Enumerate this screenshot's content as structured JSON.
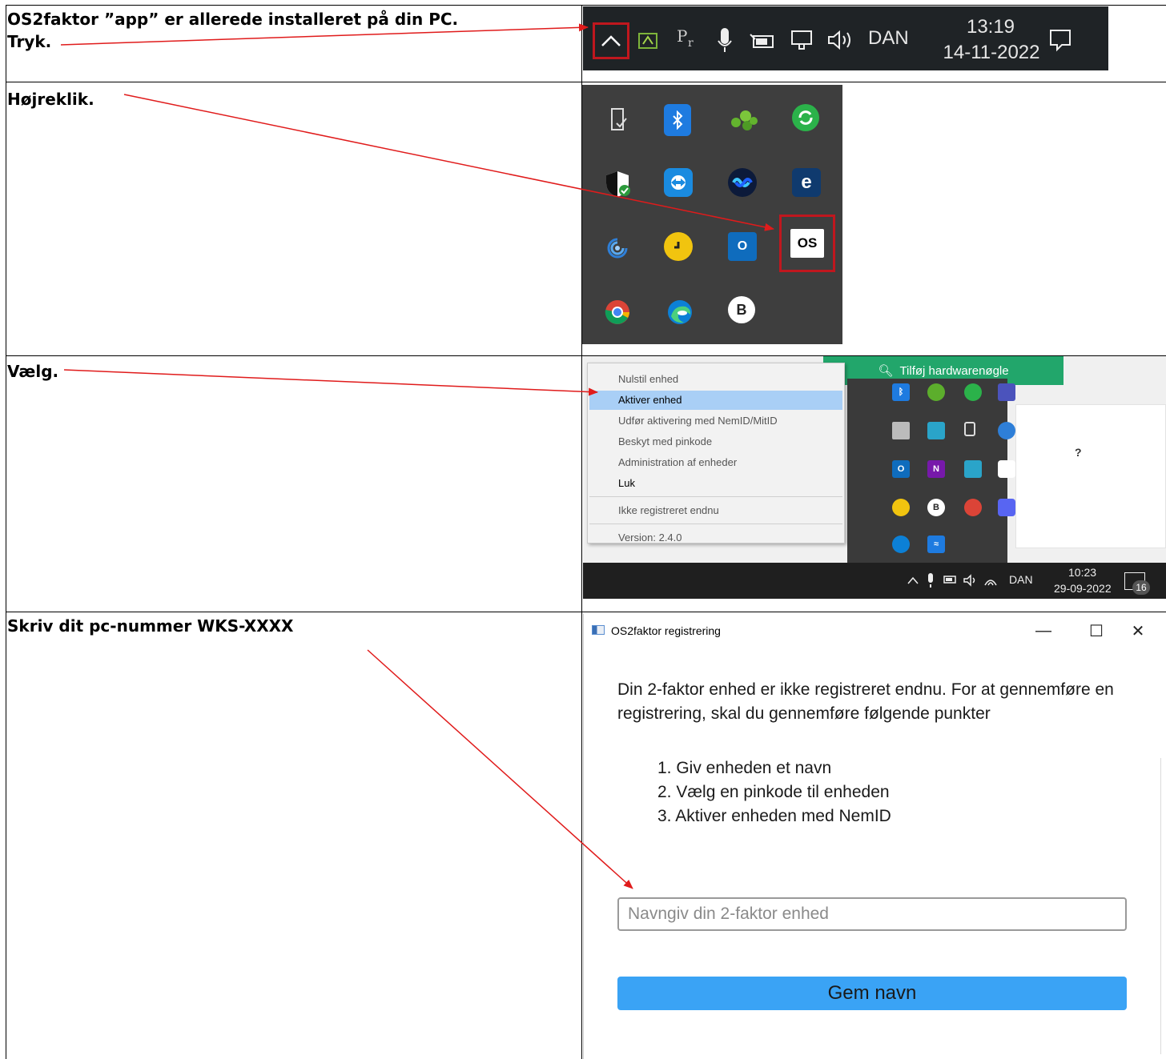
{
  "steps": {
    "step1": {
      "line1": "OS2faktor ”app” er allerede installeret på din PC.",
      "line2": "Tryk."
    },
    "step2": {
      "text": "Højreklik."
    },
    "step3": {
      "text": "Vælg."
    },
    "step4": {
      "text": "Skriv dit pc-nummer WKS-XXXX"
    }
  },
  "taskbar1": {
    "lang": "DAN",
    "time": "13:19",
    "date": "14-11-2022",
    "icons": [
      "chevron-up-icon",
      "app-green-icon",
      "pr-icon",
      "microphone-icon",
      "battery-icon",
      "network-icon",
      "speaker-icon",
      "notification-icon"
    ]
  },
  "tray2": {
    "icons": [
      "usb-icon",
      "bluetooth-icon",
      "green-dots-icon",
      "green-sync-icon",
      "shield-icon",
      "teamviewer-icon",
      "webex-icon",
      "e-icon",
      "swirl-icon",
      "clock-icon",
      "outlook-icon",
      "os2faktor-icon",
      "chrome-icon",
      "edge-icon",
      "b-icon"
    ],
    "os2_label": "OS",
    "b_label": "B",
    "e_label": "e",
    "o_label": "O"
  },
  "menu3": {
    "top_button": "Tilføj hardwarenøgle",
    "items": [
      {
        "label": "Nulstil enhed"
      },
      {
        "label": "Aktiver enhed"
      },
      {
        "label": "Udfør aktivering med NemID/MitID"
      },
      {
        "label": "Beskyt med pinkode"
      },
      {
        "label": "Administration af enheder"
      },
      {
        "label": "Luk"
      },
      {
        "label": "Ikke registreret endnu"
      },
      {
        "label": "Version: 2.4.0"
      }
    ],
    "question": "?",
    "taskbar": {
      "lang": "DAN",
      "time": "10:23",
      "date": "29-09-2022",
      "badge": "16"
    }
  },
  "window4": {
    "title": "OS2faktor registrering",
    "intro": "Din 2-faktor enhed er ikke registreret endnu. For at gennemføre en registrering, skal du gennemføre følgende punkter",
    "list": [
      "1. Giv enheden et navn",
      "2. Vælg en pinkode til enheden",
      "3. Aktiver enheden med NemID"
    ],
    "input_placeholder": "Navngiv din 2-faktor enhed",
    "save_label": "Gem navn",
    "minimize": "—",
    "maximize": "☐",
    "close": "✕"
  },
  "colors": {
    "accent_red": "#e01b1b",
    "highlight_box": "#c0171e",
    "save_button": "#3aa3f5",
    "menu_highlight": "#a9cff6",
    "green_button": "#22a66b"
  }
}
